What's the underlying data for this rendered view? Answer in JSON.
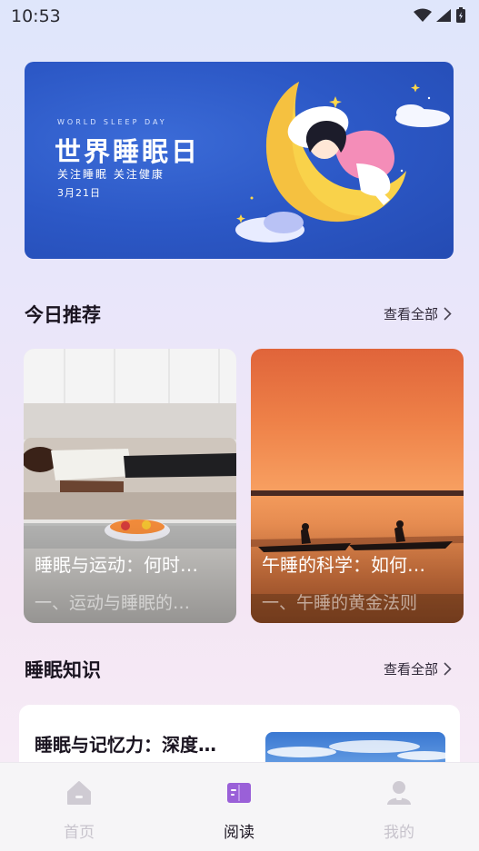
{
  "status_bar": {
    "time": "10:53"
  },
  "banner": {
    "small_text": "WORLD SLEEP DAY",
    "title": "世界睡眠日",
    "subtitle": "关注睡眠  关注健康",
    "date": "3月21日"
  },
  "recommend": {
    "title": "今日推荐",
    "see_all": "查看全部",
    "cards": [
      {
        "title": "睡眠与运动：何时…",
        "subtitle": "一、运动与睡眠的…"
      },
      {
        "title": "午睡的科学：如何…",
        "subtitle": "一、午睡的黄金法则"
      }
    ]
  },
  "knowledge": {
    "title": "睡眠知识",
    "see_all": "查看全部",
    "items": [
      {
        "title": "睡眠与记忆力：深度…"
      }
    ]
  },
  "bottom_nav": {
    "items": [
      {
        "label": "首页",
        "icon": "home-icon",
        "active": false
      },
      {
        "label": "阅读",
        "icon": "book-icon",
        "active": true
      },
      {
        "label": "我的",
        "icon": "user-icon",
        "active": false
      }
    ]
  },
  "colors": {
    "accent": "#9a60d8",
    "banner_blue": "#2c58c6",
    "nav_inactive": "#c7c3cc"
  }
}
